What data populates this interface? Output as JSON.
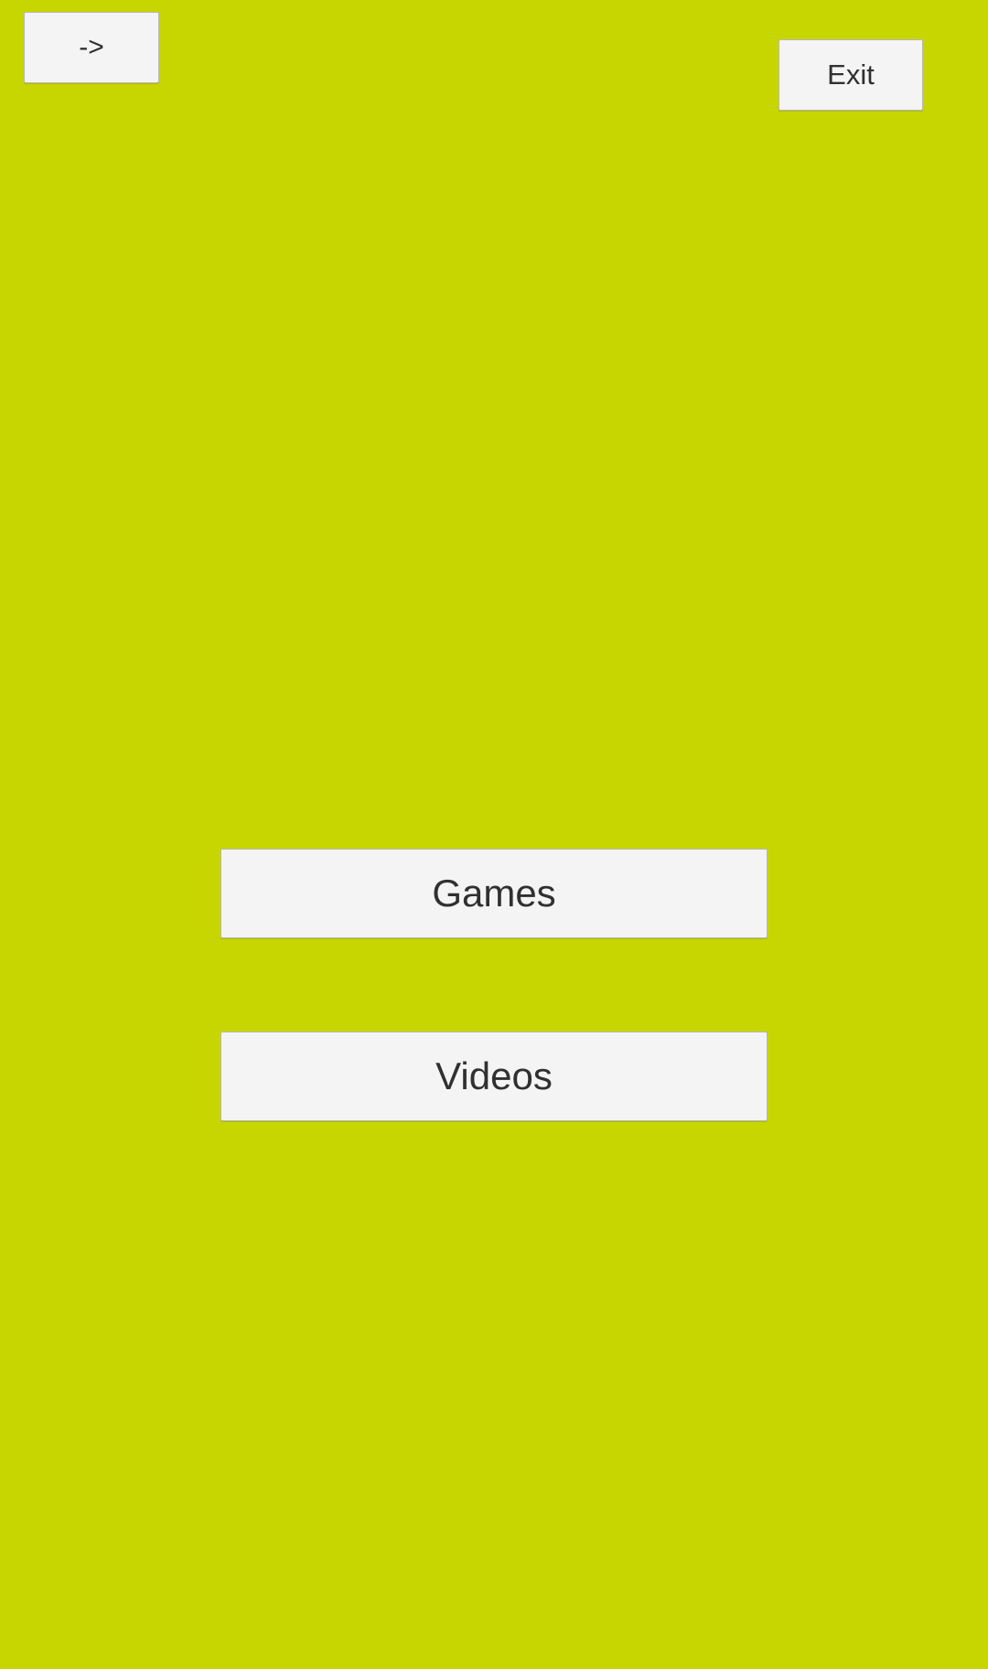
{
  "theme": {
    "background": "#c7d600",
    "button_bg": "#f4f4f4",
    "button_border": "#b7b7b7",
    "button_text": "#303030"
  },
  "toolbar": {
    "forward_label": "->",
    "exit_label": "Exit"
  },
  "menu": {
    "games_label": "Games",
    "videos_label": "Videos"
  }
}
